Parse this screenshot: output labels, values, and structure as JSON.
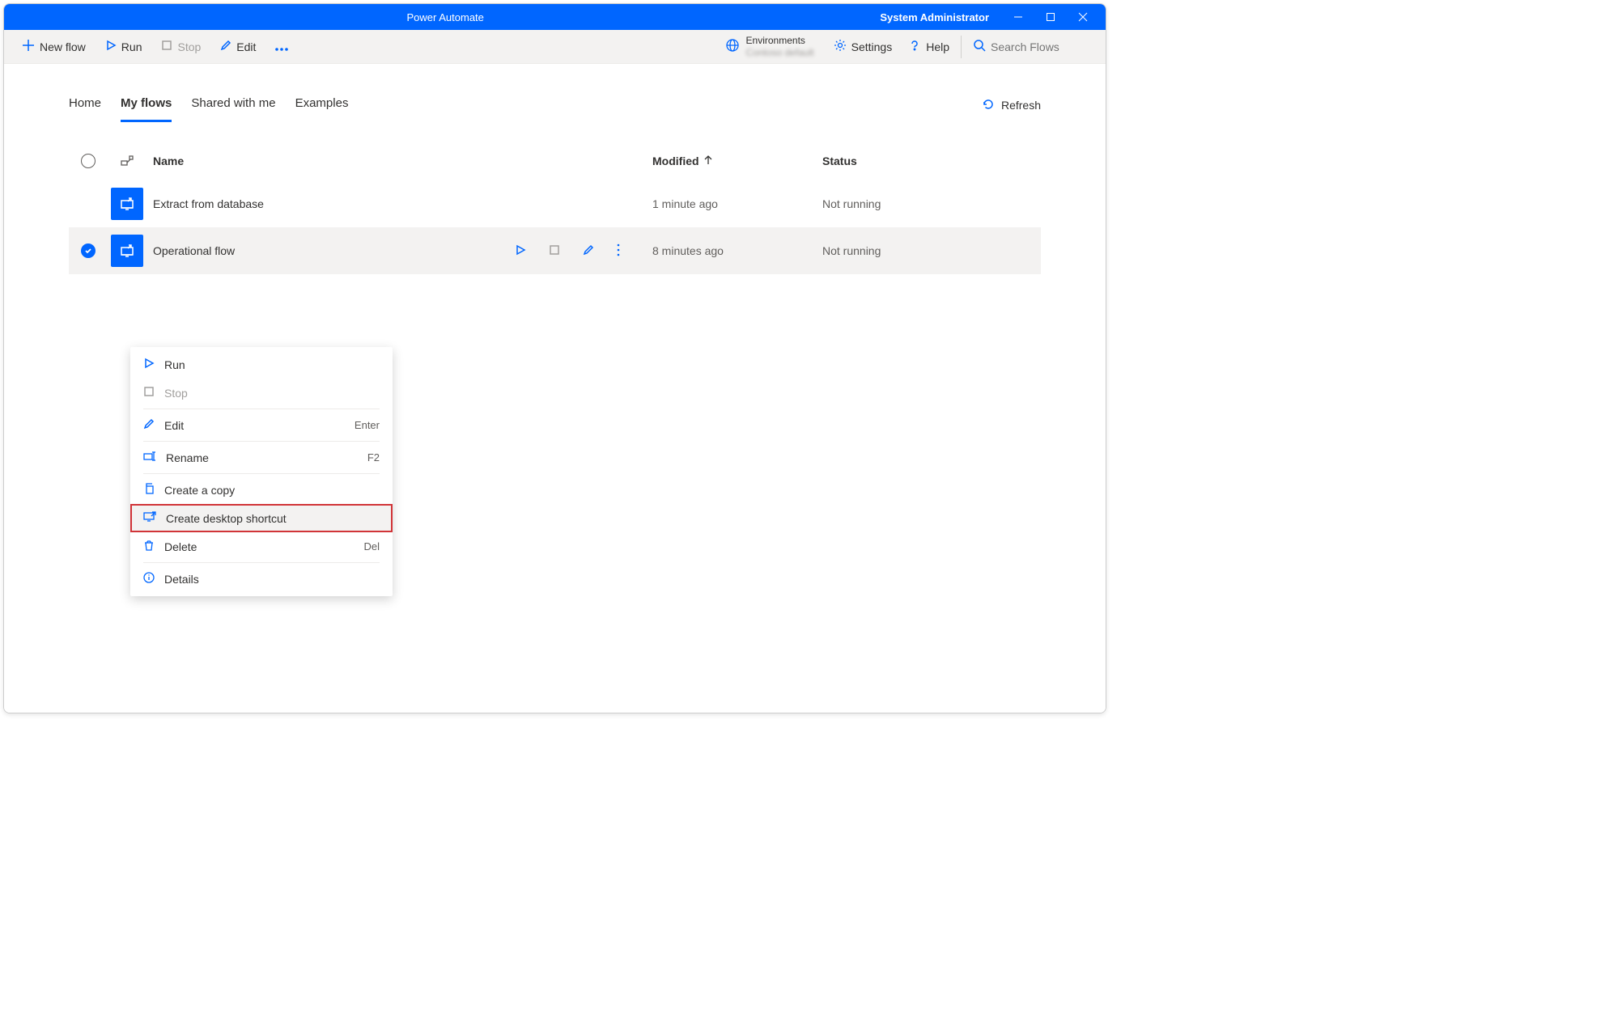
{
  "titlebar": {
    "app_title": "Power Automate",
    "user": "System Administrator"
  },
  "cmdbar": {
    "new_flow": "New flow",
    "run": "Run",
    "stop": "Stop",
    "edit": "Edit",
    "env_label": "Environments",
    "env_value": "Contoso default",
    "settings": "Settings",
    "help": "Help",
    "search_placeholder": "Search Flows"
  },
  "tabs": {
    "home": "Home",
    "my_flows": "My flows",
    "shared": "Shared with me",
    "examples": "Examples",
    "refresh": "Refresh"
  },
  "table": {
    "headers": {
      "name": "Name",
      "modified": "Modified",
      "status": "Status"
    },
    "rows": [
      {
        "name": "Extract from database",
        "modified": "1 minute ago",
        "status": "Not running",
        "selected": false
      },
      {
        "name": "Operational flow",
        "modified": "8 minutes ago",
        "status": "Not running",
        "selected": true
      }
    ]
  },
  "ctx": {
    "run": "Run",
    "stop": "Stop",
    "edit": "Edit",
    "edit_key": "Enter",
    "rename": "Rename",
    "rename_key": "F2",
    "copy": "Create a copy",
    "shortcut": "Create desktop shortcut",
    "delete": "Delete",
    "delete_key": "Del",
    "details": "Details"
  }
}
